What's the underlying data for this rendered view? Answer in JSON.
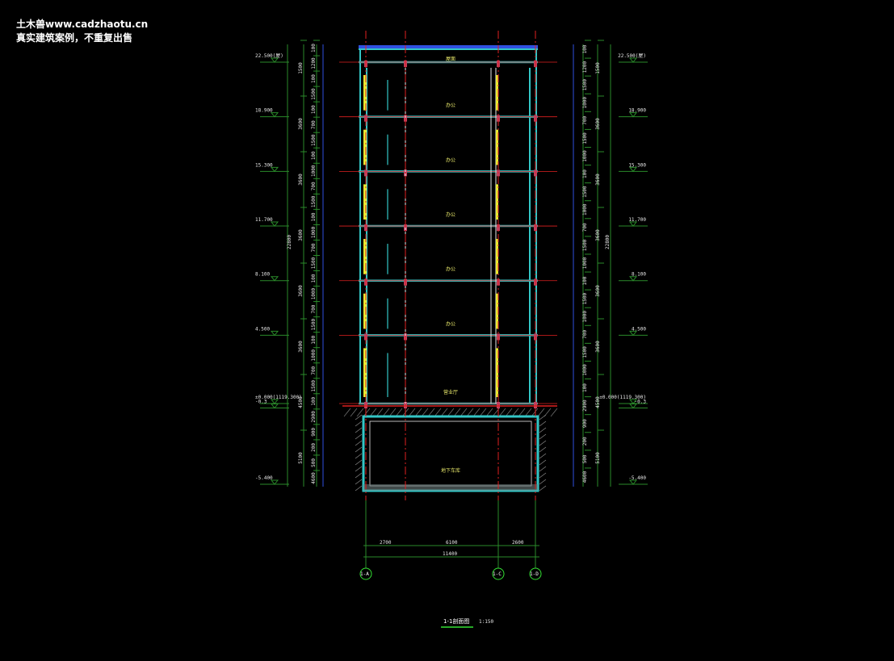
{
  "watermark": {
    "line1": "土木兽www.cadzhaotu.cn",
    "line2": "真实建筑案例，不重复出售"
  },
  "drawing": {
    "title": "1-1剖面图",
    "scale": "1:150",
    "colors": {
      "background": "#000000",
      "wall": "#33c6c6",
      "axis_line": "#e02020",
      "dimension": "#2a8a2a",
      "dim_blue": "#3050e0",
      "window": "#e8e830",
      "column": "#c04060"
    },
    "elevations": [
      {
        "label": "22.500(屋)",
        "value": 22.5
      },
      {
        "label": "18.900",
        "value": 18.9
      },
      {
        "label": "15.300",
        "value": 15.3
      },
      {
        "label": "11.700",
        "value": 11.7
      },
      {
        "label": "8.100",
        "value": 8.1
      },
      {
        "label": "4.500",
        "value": 4.5
      },
      {
        "label": "±0.000(1119.300)",
        "value": 0.0
      },
      {
        "label": "-0.3",
        "value": -0.3
      },
      {
        "label": "-5.400",
        "value": -5.4
      }
    ],
    "outer_dims_left": [
      "1500",
      "3600",
      "3600",
      "3600",
      "3600",
      "3600",
      "4500",
      "5100"
    ],
    "total_height": "22800",
    "total_height_below": "4600",
    "inner_dims_left": [
      "100",
      "1200",
      "100",
      "1500",
      "100",
      "700",
      "1500",
      "100",
      "1000",
      "700",
      "1500",
      "100",
      "1000",
      "700",
      "1500",
      "100",
      "1000",
      "700",
      "1500",
      "100",
      "1000",
      "700",
      "1500",
      "100",
      "2900",
      "900",
      "200",
      "500",
      "4600"
    ],
    "inner_dims_right": [
      "100",
      "1200",
      "1500",
      "1000",
      "700",
      "1500",
      "1000",
      "100",
      "1500",
      "1000",
      "700",
      "1500",
      "1000",
      "100",
      "1500",
      "1000",
      "700",
      "1500",
      "1000",
      "100",
      "2900",
      "900",
      "200",
      "500",
      "4600"
    ],
    "room_labels": [
      "屋面",
      "办公",
      "办公",
      "办公",
      "办公",
      "办公",
      "营业厅",
      "地下车库"
    ],
    "bottom_dims": [
      "2700",
      "6100",
      "2600"
    ],
    "bottom_total": "11400",
    "axes": [
      "1-A",
      "1-C",
      "1-D"
    ]
  }
}
